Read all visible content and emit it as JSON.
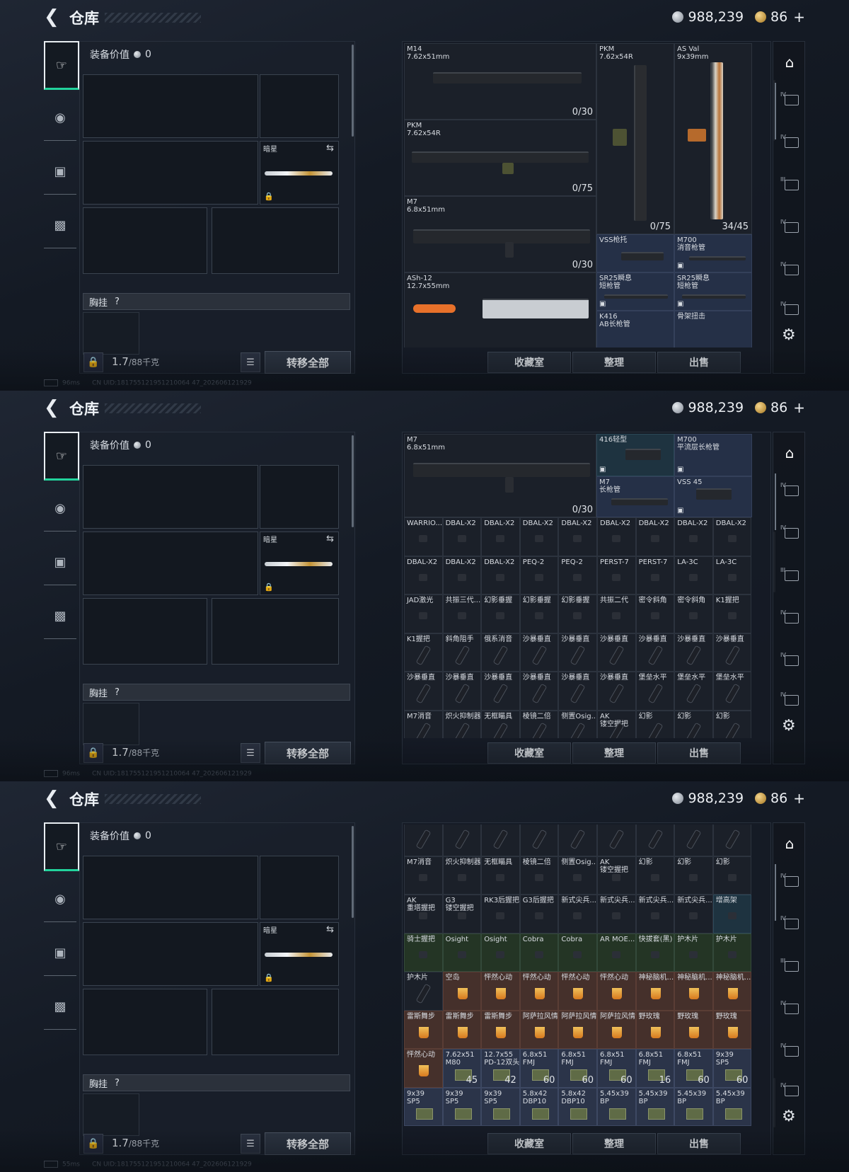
{
  "header": {
    "back_icon": "chevron-left-icon",
    "title": "仓库",
    "silver": "988,239",
    "gold": "86",
    "plus": "+"
  },
  "left": {
    "gear_value_label": "装备价值",
    "gear_value": "0",
    "knife_label": "暗星",
    "chest_label": "胸挂",
    "chest_help": "?",
    "weight": "1.7",
    "weight_cap": "/88千克",
    "transfer_all": "转移全部"
  },
  "storage_buttons": [
    "收藏室",
    "整理",
    "出售"
  ],
  "status_line": "CN UID:181755121951210064 47_202606121929",
  "status": [
    "96ms",
    "96ms",
    "55ms"
  ],
  "panel1": {
    "m14": {
      "name": "M14\n7.62x51mm",
      "count": "0/30"
    },
    "pkm_a": {
      "name": "PKM\n7.62x54R",
      "count": "0/75"
    },
    "m7": {
      "name": "M7\n6.8x51mm",
      "count": "0/30"
    },
    "ash12": {
      "name": "ASh-12\n12.7x55mm"
    },
    "pkm_b": {
      "name": "PKM\n7.62x54R",
      "count": "0/75"
    },
    "asval": {
      "name": "AS Val\n9x39mm",
      "count": "34/45"
    },
    "vss_stock": {
      "name": "VSS枪托"
    },
    "m700": {
      "name": "M700\n消音枪管"
    },
    "sr25a": {
      "name": "SR25瞬息\n短枪管"
    },
    "sr25b": {
      "name": "SR25瞬息\n短枪管"
    },
    "k416": {
      "name": "K416\nAB长枪管"
    },
    "skel": {
      "name": "骨架扭击"
    }
  },
  "panel2": {
    "m7": {
      "name": "M7\n6.8x51mm",
      "count": "0/30"
    },
    "stock416": {
      "name": "416轻型"
    },
    "m700": {
      "name": "M700\n平流层长枪管"
    },
    "m7barrel": {
      "name": "M7\n长枪管"
    },
    "vss45": {
      "name": "VSS 45"
    },
    "rows": [
      [
        "WARRIO...",
        "DBAL-X2",
        "DBAL-X2",
        "DBAL-X2",
        "DBAL-X2",
        "DBAL-X2",
        "DBAL-X2",
        "DBAL-X2",
        "DBAL-X2"
      ],
      [
        "DBAL-X2",
        "DBAL-X2",
        "DBAL-X2",
        "PEQ-2",
        "PEQ-2",
        "PERST-7",
        "PERST-7",
        "LA-3C",
        "LA-3C"
      ],
      [
        "JAD激光",
        "共振三代...",
        "幻影垂握",
        "幻影垂握",
        "幻影垂握",
        "共振二代",
        "密令斜角",
        "密令斜角",
        "K1握把"
      ],
      [
        "K1握把",
        "斜角阻手",
        "俄系消音",
        "沙暴垂直",
        "沙暴垂直",
        "沙暴垂直",
        "沙暴垂直",
        "沙暴垂直",
        "沙暴垂直"
      ],
      [
        "沙暴垂直",
        "沙暴垂直",
        "沙暴垂直",
        "沙暴垂直",
        "沙暴垂直",
        "沙暴垂直",
        "堡垒水平",
        "堡垒水平",
        "堡垒水平"
      ],
      [
        "M7消音",
        "炽火抑制器",
        "无框瞄具",
        "棱镜二倍",
        "侧置Osig...",
        "AK\n镂空握把",
        "幻影",
        "幻影",
        "幻影"
      ]
    ]
  },
  "panel3": {
    "rows": [
      [
        "",
        "",
        "",
        "",
        "",
        "",
        "",
        "",
        ""
      ],
      [
        "M7消音",
        "炽火抑制器",
        "无框瞄具",
        "棱镜二倍",
        "侧置Osig...",
        "AK\n镂空握把",
        "幻影",
        "幻影",
        "幻影"
      ],
      [
        "AK\n重塔握把",
        "G3\n镂空握把",
        "RK3后握把",
        "G3后握把",
        "新式尖兵...",
        "新式尖兵...",
        "新式尖兵...",
        "新式尖兵...",
        "增高架"
      ],
      [
        "骑士握把",
        "Osight",
        "Osight",
        "Cobra",
        "Cobra",
        "AR MOE...",
        "快拔套(黑)",
        "护木片",
        "护木片"
      ],
      [
        "护木片",
        "空岛",
        "怦然心动",
        "怦然心动",
        "怦然心动",
        "怦然心动",
        "神秘脑机...",
        "神秘脑机...",
        "神秘脑机..."
      ],
      [
        "雷斯舞步",
        "雷斯舞步",
        "雷斯舞步",
        "阿萨拉风情",
        "阿萨拉风情",
        "阿萨拉风情",
        "野玫瑰",
        "野玫瑰",
        "野玫瑰"
      ],
      [
        "怦然心动",
        "7.62x51\nM80",
        "12.7x55\nPD-12双头",
        "6.8x51\nFMJ",
        "6.8x51\nFMJ",
        "6.8x51\nFMJ",
        "6.8x51\nFMJ",
        "6.8x51\nFMJ",
        "9x39\nSP5"
      ],
      [
        "9x39\nSP5",
        "9x39\nSP5",
        "9x39\nSP5",
        "5.8x42\nDBP10",
        "5.8x42\nDBP10",
        "5.45x39\nBP",
        "5.45x39\nBP",
        "5.45x39\nBP",
        "5.45x39\nBP"
      ]
    ],
    "counts6": [
      "",
      "45",
      "42",
      "60",
      "60",
      "60",
      "16",
      "60",
      "60"
    ]
  },
  "rail_marks": [
    "IV",
    "IV",
    "III",
    "IV",
    "IV",
    "IV"
  ],
  "colors": {
    "accent": "#22d39c",
    "food": "#45302b",
    "mod": "#253047"
  }
}
